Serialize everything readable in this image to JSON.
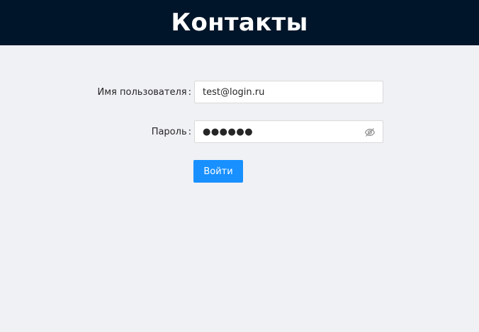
{
  "header": {
    "title": "Контакты"
  },
  "login_form": {
    "username": {
      "label": "Имя пользователя",
      "colon": ":",
      "value": "test@login.ru"
    },
    "password": {
      "label": "Пароль",
      "colon": ":",
      "masked_value": "●●●●●●",
      "visibility_icon": "eye-invisible-icon"
    },
    "submit_label": "Войти"
  },
  "colors": {
    "header_background": "#001529",
    "page_background": "#f0f1f5",
    "primary_button": "#1890ff"
  }
}
